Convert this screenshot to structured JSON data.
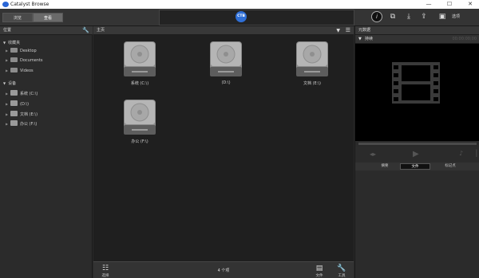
{
  "app": {
    "title": "Catalyst Browse"
  },
  "window_controls": {
    "minimize": "—",
    "maximize": "☐",
    "close": "✕"
  },
  "toolbar": {
    "tabs": [
      {
        "label": "浏览"
      },
      {
        "label": "查看"
      }
    ],
    "logo_text": "CTB",
    "options_label": "选项"
  },
  "left_panel": {
    "header": "位置",
    "favorites_label": "收藏夹",
    "favorites": [
      {
        "label": "Desktop"
      },
      {
        "label": "Documents"
      },
      {
        "label": "Videos"
      }
    ],
    "devices_label": "设备",
    "devices": [
      {
        "label": "系统 (C:\\)"
      },
      {
        "label": "(D:\\)"
      },
      {
        "label": "文档 (E:\\)"
      },
      {
        "label": "办公 (F:\\)"
      }
    ]
  },
  "center": {
    "header": "主页",
    "drives": [
      {
        "label": "系统 (C:\\)"
      },
      {
        "label": "(D:\\)"
      },
      {
        "label": "文档 (E:\\)"
      },
      {
        "label": "办公 (F:\\)"
      }
    ],
    "status_count": "4 个项",
    "bottom_buttons": {
      "select": "选择",
      "file": "文件",
      "tools": "工具"
    }
  },
  "right_panel": {
    "header": "元数据",
    "section": "持续",
    "timecode": "00:00:00;00",
    "tabs": [
      {
        "label": "摘要"
      },
      {
        "label": "文件"
      },
      {
        "label": "标记点"
      }
    ]
  },
  "colors": {
    "accent": "#2f6fd6",
    "background": "#1f1f1f",
    "panel": "#2b2b2b"
  }
}
